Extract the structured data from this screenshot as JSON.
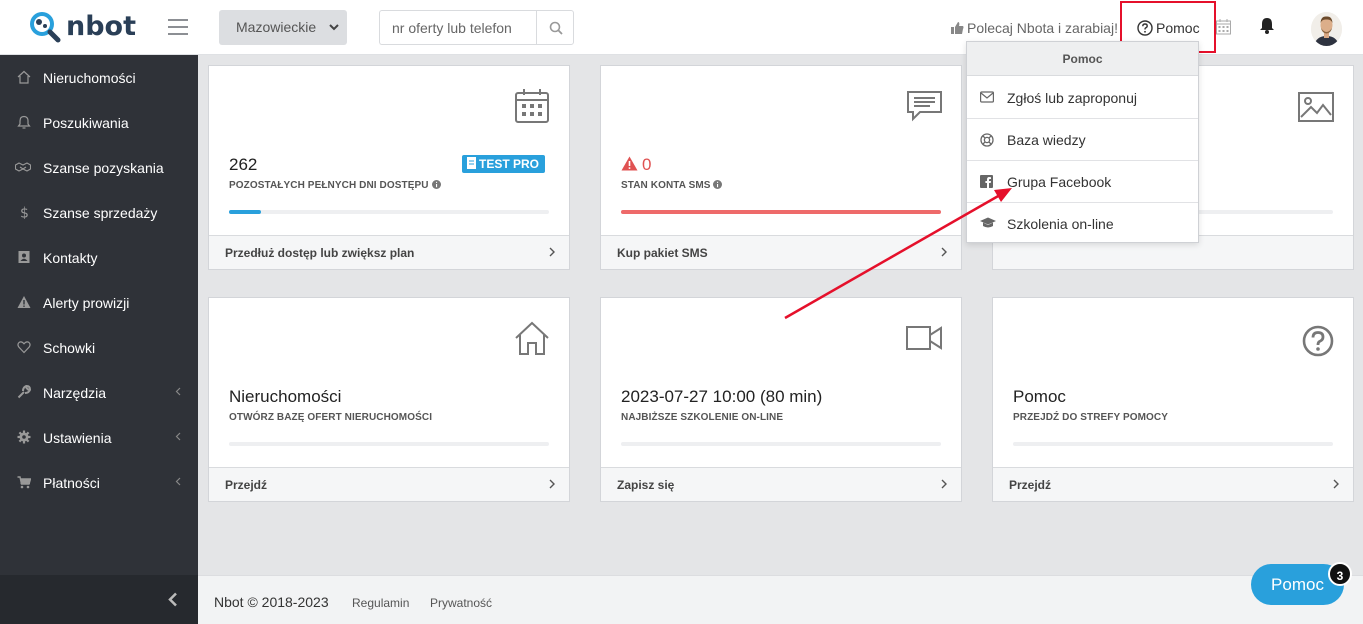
{
  "brand": {
    "name": "nbot"
  },
  "header": {
    "region_selected": "Mazowieckie",
    "search_placeholder": "nr oferty lub telefon",
    "referral_label": "Polecaj Nbota i zarabiaj!",
    "help_label": "Pomoc"
  },
  "sidebar": {
    "items": [
      {
        "label": "Nieruchomości",
        "icon": "home-icon"
      },
      {
        "label": "Poszukiwania",
        "icon": "bell-icon"
      },
      {
        "label": "Szanse pozyskania",
        "icon": "handshake-icon"
      },
      {
        "label": "Szanse sprzedaży",
        "icon": "dollar-icon"
      },
      {
        "label": "Kontakty",
        "icon": "contact-card-icon"
      },
      {
        "label": "Alerty prowizji",
        "icon": "warning-icon"
      },
      {
        "label": "Schowki",
        "icon": "heart-icon"
      },
      {
        "label": "Narzędzia",
        "icon": "wrench-icon"
      },
      {
        "label": "Ustawienia",
        "icon": "gear-icon"
      },
      {
        "label": "Płatności",
        "icon": "cart-icon"
      }
    ]
  },
  "cards": [
    {
      "value": "262",
      "sub": "POZOSTAŁYCH PEŁNYCH DNI DOSTĘPU",
      "badge": "TEST PRO",
      "footer": "Przedłuż dostęp lub zwiększ plan",
      "progress": 0.1,
      "bar_color": "#29a0dc"
    },
    {
      "value": "0",
      "sub": "STAN KONTA SMS",
      "footer": "Kup pakiet SMS",
      "progress": 1.0,
      "bar_color": "#ee6a6a",
      "value_color": "#e05252"
    },
    {
      "value": "",
      "sub": "",
      "footer": "",
      "progress": 0,
      "bar_color": "#29a0dc"
    },
    {
      "value": "Nieruchomości",
      "sub": "OTWÓRZ BAZĘ OFERT NIERUCHOMOŚCI",
      "footer": "Przejdź",
      "progress": 0,
      "bar_color": "#29a0dc"
    },
    {
      "value": "2023-07-27 10:00 (80 min)",
      "sub": "NAJBIŻSZE SZKOLENIE ON-LINE",
      "footer": "Zapisz się",
      "progress": 0,
      "bar_color": "#29a0dc"
    },
    {
      "value": "Pomoc",
      "sub": "PRZEJDŹ DO STREFY POMOCY",
      "footer": "Przejdź",
      "progress": 0,
      "bar_color": "#29a0dc"
    }
  ],
  "dropdown": {
    "title": "Pomoc",
    "items": [
      {
        "label": "Zgłoś lub zaproponuj",
        "icon": "envelope-icon"
      },
      {
        "label": "Baza wiedzy",
        "icon": "lifebuoy-icon"
      },
      {
        "label": "Grupa Facebook",
        "icon": "facebook-icon"
      },
      {
        "label": "Szkolenia on-line",
        "icon": "graduation-cap-icon"
      }
    ]
  },
  "footer": {
    "copyright": "Nbot © 2018-2023",
    "links": [
      "Regulamin",
      "Prywatność"
    ]
  },
  "help_widget": {
    "label": "Pomoc",
    "count": "3"
  },
  "colors": {
    "accent": "#29a0dc",
    "sidebar": "#2f3238",
    "annotation": "#e5102b"
  }
}
